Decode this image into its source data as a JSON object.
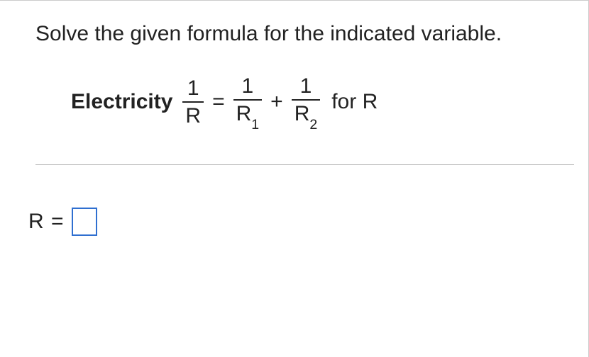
{
  "instruction": "Solve the given formula for the indicated variable.",
  "formula": {
    "label": "Electricity",
    "lhs": {
      "num": "1",
      "den": "R"
    },
    "eq": "=",
    "term1": {
      "num": "1",
      "den_base": "R",
      "den_sub": "1"
    },
    "plus": "+",
    "term2": {
      "num": "1",
      "den_base": "R",
      "den_sub": "2"
    },
    "for_text": "for R"
  },
  "answer": {
    "prefix_var": "R",
    "prefix_eq": "=",
    "value": ""
  }
}
